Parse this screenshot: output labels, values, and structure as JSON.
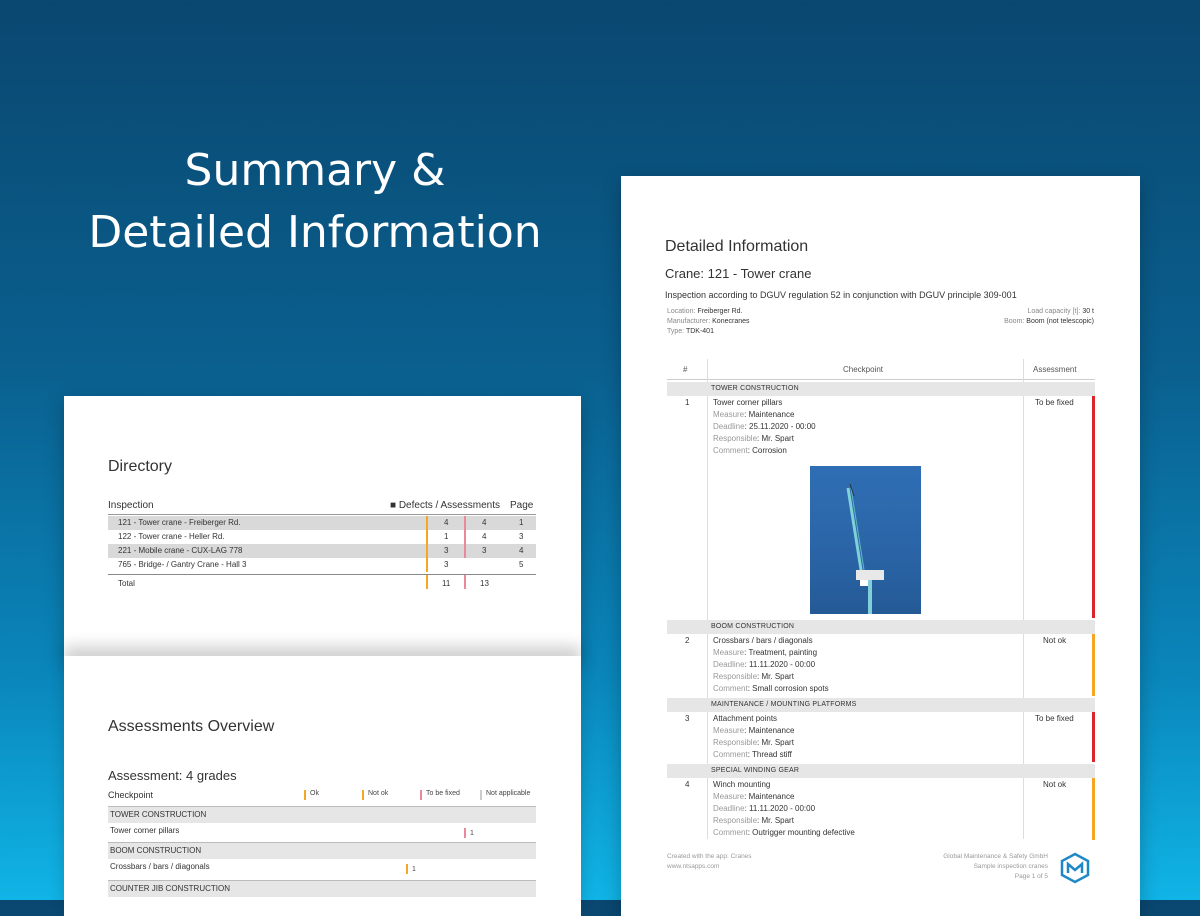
{
  "headline": {
    "line1": "Summary &",
    "line2": "Detailed Information"
  },
  "directory": {
    "title": "Directory",
    "col_inspection": "Inspection",
    "col_defects": "Defects / Assessments",
    "col_page": "Page",
    "rows": [
      {
        "name": "121 - Tower crane - Freiberger Rd.",
        "defects": "4",
        "assessments": "4",
        "page": "1"
      },
      {
        "name": "122 - Tower crane - Heller Rd.",
        "defects": "1",
        "assessments": "4",
        "page": "3"
      },
      {
        "name": "221 - Mobile crane - CUX-LAG 778",
        "defects": "3",
        "assessments": "3",
        "page": "4"
      },
      {
        "name": "765 - Bridge- / Gantry Crane - Hall 3",
        "defects": "3",
        "assessments": "",
        "page": "5"
      }
    ],
    "total_label": "Total",
    "total_defects": "11",
    "total_assessments": "13"
  },
  "assessments_overview": {
    "title": "Assessments Overview",
    "subtitle": "Assessment: 4 grades",
    "col_checkpoint": "Checkpoint",
    "grades": [
      "Ok",
      "Not ok",
      "To be fixed",
      "Not applicable"
    ],
    "sections": [
      {
        "name": "TOWER CONSTRUCTION",
        "row": "Tower corner pillars",
        "value": "1"
      },
      {
        "name": "BOOM CONSTRUCTION",
        "row": "Crossbars / bars / diagonals",
        "value": "1"
      },
      {
        "name": "COUNTER JIB CONSTRUCTION"
      }
    ]
  },
  "detail": {
    "title": "Detailed Information",
    "crane": "Crane: 121 - Tower crane",
    "regulation": "Inspection according to DGUV regulation 52 in conjunction with DGUV principle 309-001",
    "meta": {
      "location_label": "Location:",
      "location": "Freiberger Rd.",
      "manufacturer_label": "Manufacturer:",
      "manufacturer": "Konecranes",
      "type_label": "Type:",
      "type": "TDK-401",
      "load_label": "Load capacity [t]:",
      "load": "30 t",
      "boom_label": "Boom:",
      "boom": "Boom (not telescopic)"
    },
    "col_no": "#",
    "col_checkpoint": "Checkpoint",
    "col_assessment": "Assessment",
    "labels": {
      "measure": "Measure",
      "deadline": "Deadline",
      "responsible": "Responsible",
      "comment": "Comment"
    },
    "items": [
      {
        "section": "TOWER CONSTRUCTION",
        "no": "1",
        "checkpoint": "Tower corner pillars",
        "measure": "Maintenance",
        "deadline": "25.11.2020 - 00:00",
        "responsible": "Mr. Spart",
        "comment": "Corrosion",
        "assessment": "To be fixed",
        "color": "#d9252b"
      },
      {
        "section": "BOOM CONSTRUCTION",
        "no": "2",
        "checkpoint": "Crossbars / bars / diagonals",
        "measure": "Treatment, painting",
        "deadline": "11.11.2020 - 00:00",
        "responsible": "Mr. Spart",
        "comment": "Small corrosion spots",
        "assessment": "Not ok",
        "color": "#f5a623"
      },
      {
        "section": "MAINTENANCE / MOUNTING PLATFORMS",
        "no": "3",
        "checkpoint": "Attachment points",
        "measure": "Maintenance",
        "deadline": "",
        "responsible": "Mr. Spart",
        "comment": "Thread stiff",
        "assessment": "To be fixed",
        "color": "#d9252b"
      },
      {
        "section": "SPECIAL WINDING GEAR",
        "no": "4",
        "checkpoint": "Winch mounting",
        "measure": "Maintenance",
        "deadline": "11.11.2020 - 00:00",
        "responsible": "Mr. Spart",
        "comment": "Outrigger mounting defective",
        "assessment": "Not ok",
        "color": "#f5a623"
      }
    ],
    "footer_left_1": "Created with the app: Cranes",
    "footer_left_2": "www.ntsapps.com",
    "footer_right_1": "Global Maintenance & Safety GmbH",
    "footer_right_2": "Sample inspection cranes",
    "footer_right_3": "Page 1 of 5"
  }
}
